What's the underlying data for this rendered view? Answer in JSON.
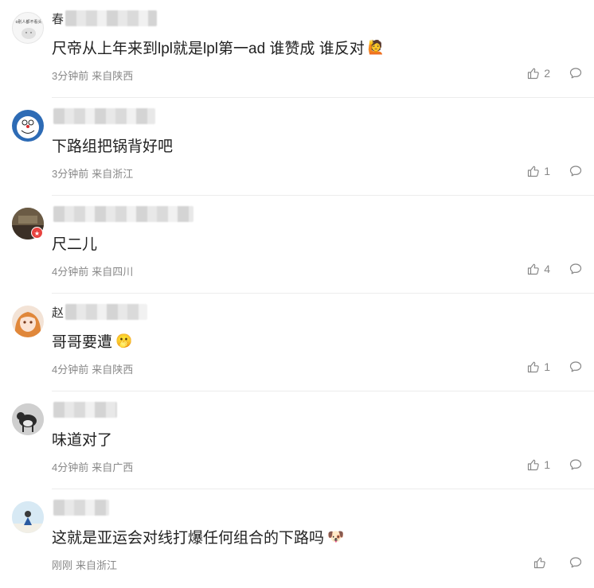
{
  "comments": [
    {
      "name_visible": "春",
      "name_blur_width": 115,
      "text": "尺帝从上年来到lpl就是lpl第一ad 谁赞成 谁反对",
      "emoji": "🙋",
      "time": "3分钟前",
      "location": "来自陕西",
      "likes": "2",
      "avatar_caption": "o别人都不看头"
    },
    {
      "name_visible": "",
      "name_blur_width": 128,
      "text": "下路组把锅背好吧",
      "emoji": "",
      "time": "3分钟前",
      "location": "来自浙江",
      "likes": "1"
    },
    {
      "name_visible": "",
      "name_blur_width": 176,
      "text": "尺二儿",
      "emoji": "",
      "time": "4分钟前",
      "location": "来自四川",
      "likes": "4"
    },
    {
      "name_visible": "赵",
      "name_blur_width": 103,
      "text": "哥哥要遭",
      "emoji": "🫢",
      "time": "4分钟前",
      "location": "来自陕西",
      "likes": "1"
    },
    {
      "name_visible": "",
      "name_blur_width": 80,
      "text": "味道对了",
      "emoji": "",
      "time": "4分钟前",
      "location": "来自广西",
      "likes": "1"
    },
    {
      "name_visible": "",
      "name_blur_width": 70,
      "text": "这就是亚运会对线打爆任何组合的下路吗",
      "emoji": "🐶",
      "time": "刚刚",
      "location": "来自浙江",
      "likes": ""
    }
  ],
  "colors": {
    "text": "#222222",
    "meta": "#888888",
    "divider": "#ececec",
    "vip_badge": "#e8433f"
  },
  "icons": {
    "like": "thumbs-up-icon",
    "reply": "speech-bubble-icon",
    "verified": "vip-badge-icon"
  }
}
